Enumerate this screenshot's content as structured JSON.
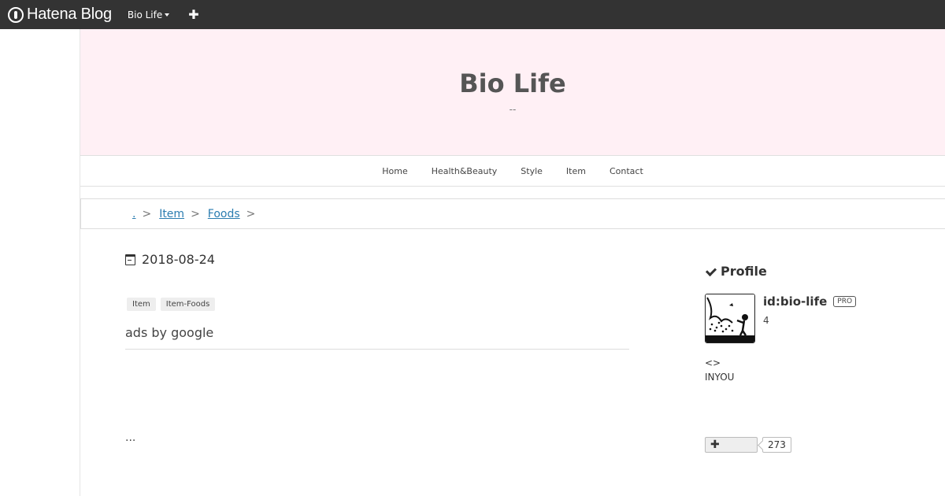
{
  "topbar": {
    "brand": "Hatena Blog",
    "blog_menu": "Bio Life",
    "add_label": "✚"
  },
  "header": {
    "title": "Bio Life",
    "description": "--"
  },
  "nav": {
    "items": [
      "Home",
      "Health&Beauty",
      "Style",
      "Item",
      "Contact"
    ]
  },
  "breadcrumb": {
    "home": ".",
    "items": [
      "Item",
      "Foods"
    ],
    "separator": ">"
  },
  "entry": {
    "date": "2018-08-24",
    "tags": [
      "Item",
      "Item-Foods"
    ],
    "ads_label": "ads by google",
    "ellipsis": "..."
  },
  "profile": {
    "heading": "Profile",
    "id": "id:bio-life",
    "badge": "PRO",
    "count": "4",
    "text1": "<>",
    "text2": "INYOU",
    "subscribe_icon": "✚",
    "subscribers": "273"
  },
  "icons": {
    "brand": "hatena-logo-icon",
    "date": "calendar-icon",
    "profile": "check-icon"
  }
}
